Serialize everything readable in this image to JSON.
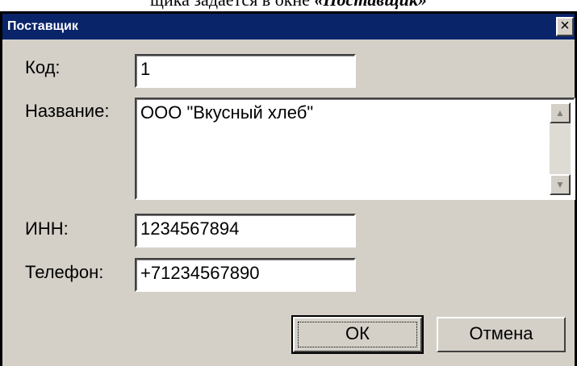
{
  "caption": {
    "prefix": "щика задается в окне ",
    "emphasis": "«Поставщик»"
  },
  "window": {
    "title": "Поставщик",
    "close_glyph": "×"
  },
  "form": {
    "code": {
      "label": "Код:",
      "value": "1"
    },
    "name": {
      "label": "Название:",
      "value": "ООО \"Вкусный хлеб\""
    },
    "inn": {
      "label": "ИНН:",
      "value": "1234567894"
    },
    "phone": {
      "label": "Телефон:",
      "value": "+71234567890"
    }
  },
  "buttons": {
    "ok": "ОК",
    "cancel": "Отмена"
  },
  "icons": {
    "close": "close-icon",
    "scroll_up": "scroll-up-arrow-icon",
    "scroll_down": "scroll-down-arrow-icon"
  },
  "colors": {
    "titlebar": "#0a246a",
    "window_face": "#d4d0c8",
    "field_background": "#ffffff"
  }
}
